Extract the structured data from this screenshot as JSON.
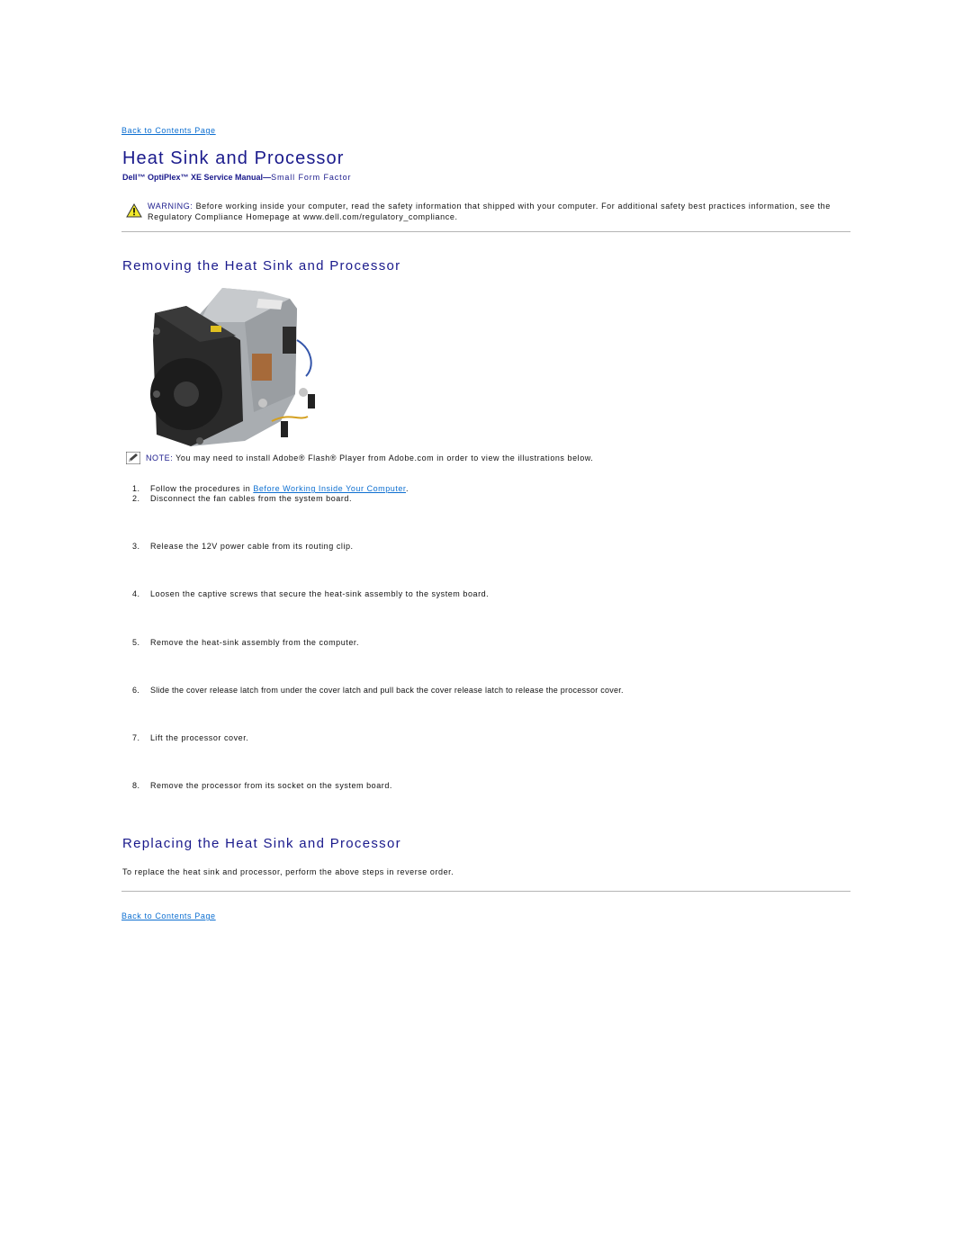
{
  "nav": {
    "back_to_contents_top": "Back to Contents Page",
    "back_to_contents_bottom": "Back to Contents Page"
  },
  "header": {
    "title": "Heat Sink and Processor",
    "subtitle_brand": "Dell™ OptiPlex™ XE Service Manual",
    "subtitle_dash": "—",
    "subtitle_form_factor": "Small Form Factor"
  },
  "warning": {
    "icon": "warning-triangle-icon",
    "label": "WARNING:",
    "text": " Before working inside your computer, read the safety information that shipped with your computer. For additional safety best practices information, see the Regulatory Compliance Homepage at www.dell.com/regulatory_compliance."
  },
  "removing": {
    "heading": "Removing the Heat Sink and Processor",
    "image_alt": "Heat sink and fan assembly",
    "note": {
      "icon": "note-pencil-icon",
      "label": "NOTE:",
      "text": " You may need to install Adobe® Flash® Player from Adobe.com in order to view the illustrations below."
    },
    "steps": [
      {
        "num": "1.",
        "prefix": "Follow the procedures in ",
        "link": "Before Working Inside Your Computer",
        "suffix": "."
      },
      {
        "num": "2.",
        "text": "Disconnect the fan cables from the system board."
      },
      {
        "num": "3.",
        "text": "Release the 12V power cable from its routing clip."
      },
      {
        "num": "4.",
        "text": "Loosen the captive screws that secure the heat-sink assembly to the system board."
      },
      {
        "num": "5.",
        "text": "Remove the heat-sink assembly from the computer."
      },
      {
        "num": "6.",
        "text": "Slide the cover release latch from under the cover latch and pull back the cover release latch to release the processor cover."
      },
      {
        "num": "7.",
        "text": "Lift the processor cover."
      },
      {
        "num": "8.",
        "text": "Remove the processor from its socket on the system board."
      }
    ]
  },
  "replacing": {
    "heading": "Replacing the Heat Sink and Processor",
    "text": "To replace the heat sink and processor, perform the above steps in reverse order."
  }
}
